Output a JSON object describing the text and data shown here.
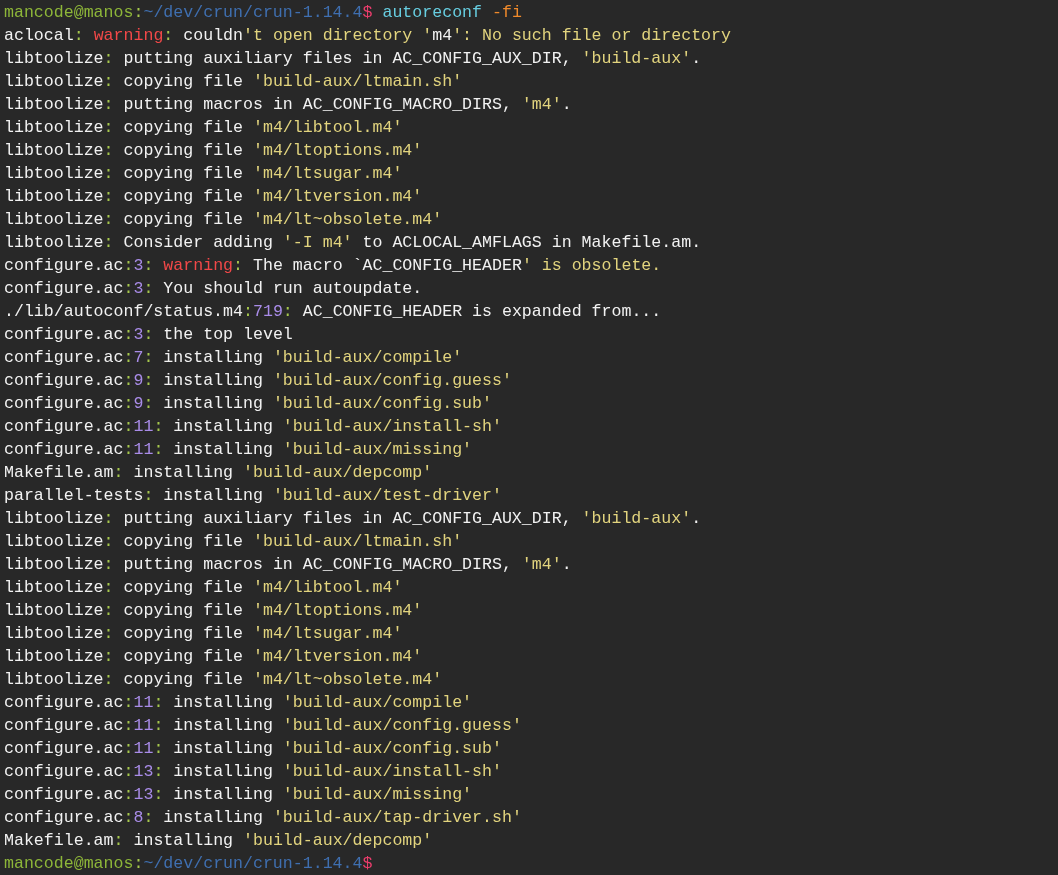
{
  "terminal": {
    "lines": [
      [
        {
          "kind": "user",
          "text": "mancode@manos"
        },
        {
          "kind": "colon",
          "text": ":"
        },
        {
          "kind": "path",
          "text": "~/dev/crun/crun-1.14.4"
        },
        {
          "kind": "dollar",
          "text": "$"
        },
        {
          "kind": "command",
          "text": " autoreconf"
        },
        {
          "kind": "flag",
          "text": " -fi"
        }
      ],
      [
        {
          "kind": "plain",
          "text": "aclocal"
        },
        {
          "kind": "colon",
          "text": ": "
        },
        {
          "kind": "warning",
          "text": "warning"
        },
        {
          "kind": "colon",
          "text": ": "
        },
        {
          "kind": "plain",
          "text": "couldn"
        },
        {
          "kind": "string",
          "text": "'t open directory '"
        },
        {
          "kind": "plain",
          "text": "m4"
        },
        {
          "kind": "string",
          "text": "': No such file or directory"
        }
      ],
      [
        {
          "kind": "plain",
          "text": "libtoolize"
        },
        {
          "kind": "colon",
          "text": ": "
        },
        {
          "kind": "plain",
          "text": "putting auxiliary files in AC_CONFIG_AUX_DIR, "
        },
        {
          "kind": "string",
          "text": "'build-aux'"
        },
        {
          "kind": "plain",
          "text": "."
        }
      ],
      [
        {
          "kind": "plain",
          "text": "libtoolize"
        },
        {
          "kind": "colon",
          "text": ": "
        },
        {
          "kind": "plain",
          "text": "copying file "
        },
        {
          "kind": "string",
          "text": "'build-aux/ltmain.sh'"
        }
      ],
      [
        {
          "kind": "plain",
          "text": "libtoolize"
        },
        {
          "kind": "colon",
          "text": ": "
        },
        {
          "kind": "plain",
          "text": "putting macros in AC_CONFIG_MACRO_DIRS, "
        },
        {
          "kind": "string",
          "text": "'m4'"
        },
        {
          "kind": "plain",
          "text": "."
        }
      ],
      [
        {
          "kind": "plain",
          "text": "libtoolize"
        },
        {
          "kind": "colon",
          "text": ": "
        },
        {
          "kind": "plain",
          "text": "copying file "
        },
        {
          "kind": "string",
          "text": "'m4/libtool.m4'"
        }
      ],
      [
        {
          "kind": "plain",
          "text": "libtoolize"
        },
        {
          "kind": "colon",
          "text": ": "
        },
        {
          "kind": "plain",
          "text": "copying file "
        },
        {
          "kind": "string",
          "text": "'m4/ltoptions.m4'"
        }
      ],
      [
        {
          "kind": "plain",
          "text": "libtoolize"
        },
        {
          "kind": "colon",
          "text": ": "
        },
        {
          "kind": "plain",
          "text": "copying file "
        },
        {
          "kind": "string",
          "text": "'m4/ltsugar.m4'"
        }
      ],
      [
        {
          "kind": "plain",
          "text": "libtoolize"
        },
        {
          "kind": "colon",
          "text": ": "
        },
        {
          "kind": "plain",
          "text": "copying file "
        },
        {
          "kind": "string",
          "text": "'m4/ltversion.m4'"
        }
      ],
      [
        {
          "kind": "plain",
          "text": "libtoolize"
        },
        {
          "kind": "colon",
          "text": ": "
        },
        {
          "kind": "plain",
          "text": "copying file "
        },
        {
          "kind": "string",
          "text": "'m4/lt~obsolete.m4'"
        }
      ],
      [
        {
          "kind": "plain",
          "text": "libtoolize"
        },
        {
          "kind": "colon",
          "text": ": "
        },
        {
          "kind": "plain",
          "text": "Consider adding "
        },
        {
          "kind": "string",
          "text": "'-I m4'"
        },
        {
          "kind": "plain",
          "text": " to ACLOCAL_AMFLAGS in Makefile.am."
        }
      ],
      [
        {
          "kind": "plain",
          "text": "configure.ac"
        },
        {
          "kind": "colon",
          "text": ":"
        },
        {
          "kind": "number",
          "text": "3"
        },
        {
          "kind": "colon",
          "text": ": "
        },
        {
          "kind": "warning",
          "text": "warning"
        },
        {
          "kind": "colon",
          "text": ": "
        },
        {
          "kind": "plain",
          "text": "The macro `AC_CONFIG_HEADER"
        },
        {
          "kind": "string",
          "text": "' is obsolete."
        }
      ],
      [
        {
          "kind": "plain",
          "text": "configure.ac"
        },
        {
          "kind": "colon",
          "text": ":"
        },
        {
          "kind": "number",
          "text": "3"
        },
        {
          "kind": "colon",
          "text": ": "
        },
        {
          "kind": "plain",
          "text": "You should run autoupdate."
        }
      ],
      [
        {
          "kind": "plain",
          "text": "./lib/autoconf/status.m4"
        },
        {
          "kind": "colon",
          "text": ":"
        },
        {
          "kind": "number",
          "text": "719"
        },
        {
          "kind": "colon",
          "text": ": "
        },
        {
          "kind": "plain",
          "text": "AC_CONFIG_HEADER is expanded from..."
        }
      ],
      [
        {
          "kind": "plain",
          "text": "configure.ac"
        },
        {
          "kind": "colon",
          "text": ":"
        },
        {
          "kind": "number",
          "text": "3"
        },
        {
          "kind": "colon",
          "text": ": "
        },
        {
          "kind": "plain",
          "text": "the top level"
        }
      ],
      [
        {
          "kind": "plain",
          "text": "configure.ac"
        },
        {
          "kind": "colon",
          "text": ":"
        },
        {
          "kind": "number",
          "text": "7"
        },
        {
          "kind": "colon",
          "text": ": "
        },
        {
          "kind": "plain",
          "text": "installing "
        },
        {
          "kind": "string",
          "text": "'build-aux/compile'"
        }
      ],
      [
        {
          "kind": "plain",
          "text": "configure.ac"
        },
        {
          "kind": "colon",
          "text": ":"
        },
        {
          "kind": "number",
          "text": "9"
        },
        {
          "kind": "colon",
          "text": ": "
        },
        {
          "kind": "plain",
          "text": "installing "
        },
        {
          "kind": "string",
          "text": "'build-aux/config.guess'"
        }
      ],
      [
        {
          "kind": "plain",
          "text": "configure.ac"
        },
        {
          "kind": "colon",
          "text": ":"
        },
        {
          "kind": "number",
          "text": "9"
        },
        {
          "kind": "colon",
          "text": ": "
        },
        {
          "kind": "plain",
          "text": "installing "
        },
        {
          "kind": "string",
          "text": "'build-aux/config.sub'"
        }
      ],
      [
        {
          "kind": "plain",
          "text": "configure.ac"
        },
        {
          "kind": "colon",
          "text": ":"
        },
        {
          "kind": "number",
          "text": "11"
        },
        {
          "kind": "colon",
          "text": ": "
        },
        {
          "kind": "plain",
          "text": "installing "
        },
        {
          "kind": "string",
          "text": "'build-aux/install-sh'"
        }
      ],
      [
        {
          "kind": "plain",
          "text": "configure.ac"
        },
        {
          "kind": "colon",
          "text": ":"
        },
        {
          "kind": "number",
          "text": "11"
        },
        {
          "kind": "colon",
          "text": ": "
        },
        {
          "kind": "plain",
          "text": "installing "
        },
        {
          "kind": "string",
          "text": "'build-aux/missing'"
        }
      ],
      [
        {
          "kind": "plain",
          "text": "Makefile.am"
        },
        {
          "kind": "colon",
          "text": ": "
        },
        {
          "kind": "plain",
          "text": "installing "
        },
        {
          "kind": "string",
          "text": "'build-aux/depcomp'"
        }
      ],
      [
        {
          "kind": "plain",
          "text": "parallel-tests"
        },
        {
          "kind": "colon",
          "text": ": "
        },
        {
          "kind": "plain",
          "text": "installing "
        },
        {
          "kind": "string",
          "text": "'build-aux/test-driver'"
        }
      ],
      [
        {
          "kind": "plain",
          "text": "libtoolize"
        },
        {
          "kind": "colon",
          "text": ": "
        },
        {
          "kind": "plain",
          "text": "putting auxiliary files in AC_CONFIG_AUX_DIR, "
        },
        {
          "kind": "string",
          "text": "'build-aux'"
        },
        {
          "kind": "plain",
          "text": "."
        }
      ],
      [
        {
          "kind": "plain",
          "text": "libtoolize"
        },
        {
          "kind": "colon",
          "text": ": "
        },
        {
          "kind": "plain",
          "text": "copying file "
        },
        {
          "kind": "string",
          "text": "'build-aux/ltmain.sh'"
        }
      ],
      [
        {
          "kind": "plain",
          "text": "libtoolize"
        },
        {
          "kind": "colon",
          "text": ": "
        },
        {
          "kind": "plain",
          "text": "putting macros in AC_CONFIG_MACRO_DIRS, "
        },
        {
          "kind": "string",
          "text": "'m4'"
        },
        {
          "kind": "plain",
          "text": "."
        }
      ],
      [
        {
          "kind": "plain",
          "text": "libtoolize"
        },
        {
          "kind": "colon",
          "text": ": "
        },
        {
          "kind": "plain",
          "text": "copying file "
        },
        {
          "kind": "string",
          "text": "'m4/libtool.m4'"
        }
      ],
      [
        {
          "kind": "plain",
          "text": "libtoolize"
        },
        {
          "kind": "colon",
          "text": ": "
        },
        {
          "kind": "plain",
          "text": "copying file "
        },
        {
          "kind": "string",
          "text": "'m4/ltoptions.m4'"
        }
      ],
      [
        {
          "kind": "plain",
          "text": "libtoolize"
        },
        {
          "kind": "colon",
          "text": ": "
        },
        {
          "kind": "plain",
          "text": "copying file "
        },
        {
          "kind": "string",
          "text": "'m4/ltsugar.m4'"
        }
      ],
      [
        {
          "kind": "plain",
          "text": "libtoolize"
        },
        {
          "kind": "colon",
          "text": ": "
        },
        {
          "kind": "plain",
          "text": "copying file "
        },
        {
          "kind": "string",
          "text": "'m4/ltversion.m4'"
        }
      ],
      [
        {
          "kind": "plain",
          "text": "libtoolize"
        },
        {
          "kind": "colon",
          "text": ": "
        },
        {
          "kind": "plain",
          "text": "copying file "
        },
        {
          "kind": "string",
          "text": "'m4/lt~obsolete.m4'"
        }
      ],
      [
        {
          "kind": "plain",
          "text": "configure.ac"
        },
        {
          "kind": "colon",
          "text": ":"
        },
        {
          "kind": "number",
          "text": "11"
        },
        {
          "kind": "colon",
          "text": ": "
        },
        {
          "kind": "plain",
          "text": "installing "
        },
        {
          "kind": "string",
          "text": "'build-aux/compile'"
        }
      ],
      [
        {
          "kind": "plain",
          "text": "configure.ac"
        },
        {
          "kind": "colon",
          "text": ":"
        },
        {
          "kind": "number",
          "text": "11"
        },
        {
          "kind": "colon",
          "text": ": "
        },
        {
          "kind": "plain",
          "text": "installing "
        },
        {
          "kind": "string",
          "text": "'build-aux/config.guess'"
        }
      ],
      [
        {
          "kind": "plain",
          "text": "configure.ac"
        },
        {
          "kind": "colon",
          "text": ":"
        },
        {
          "kind": "number",
          "text": "11"
        },
        {
          "kind": "colon",
          "text": ": "
        },
        {
          "kind": "plain",
          "text": "installing "
        },
        {
          "kind": "string",
          "text": "'build-aux/config.sub'"
        }
      ],
      [
        {
          "kind": "plain",
          "text": "configure.ac"
        },
        {
          "kind": "colon",
          "text": ":"
        },
        {
          "kind": "number",
          "text": "13"
        },
        {
          "kind": "colon",
          "text": ": "
        },
        {
          "kind": "plain",
          "text": "installing "
        },
        {
          "kind": "string",
          "text": "'build-aux/install-sh'"
        }
      ],
      [
        {
          "kind": "plain",
          "text": "configure.ac"
        },
        {
          "kind": "colon",
          "text": ":"
        },
        {
          "kind": "number",
          "text": "13"
        },
        {
          "kind": "colon",
          "text": ": "
        },
        {
          "kind": "plain",
          "text": "installing "
        },
        {
          "kind": "string",
          "text": "'build-aux/missing'"
        }
      ],
      [
        {
          "kind": "plain",
          "text": "configure.ac"
        },
        {
          "kind": "colon",
          "text": ":"
        },
        {
          "kind": "number",
          "text": "8"
        },
        {
          "kind": "colon",
          "text": ": "
        },
        {
          "kind": "plain",
          "text": "installing "
        },
        {
          "kind": "string",
          "text": "'build-aux/tap-driver.sh'"
        }
      ],
      [
        {
          "kind": "plain",
          "text": "Makefile.am"
        },
        {
          "kind": "colon",
          "text": ": "
        },
        {
          "kind": "plain",
          "text": "installing "
        },
        {
          "kind": "string",
          "text": "'build-aux/depcomp'"
        }
      ],
      [
        {
          "kind": "user",
          "text": "mancode@manos"
        },
        {
          "kind": "colon",
          "text": ":"
        },
        {
          "kind": "path",
          "text": "~/dev/crun/crun-1.14.4"
        },
        {
          "kind": "dollar",
          "text": "$"
        }
      ]
    ]
  }
}
